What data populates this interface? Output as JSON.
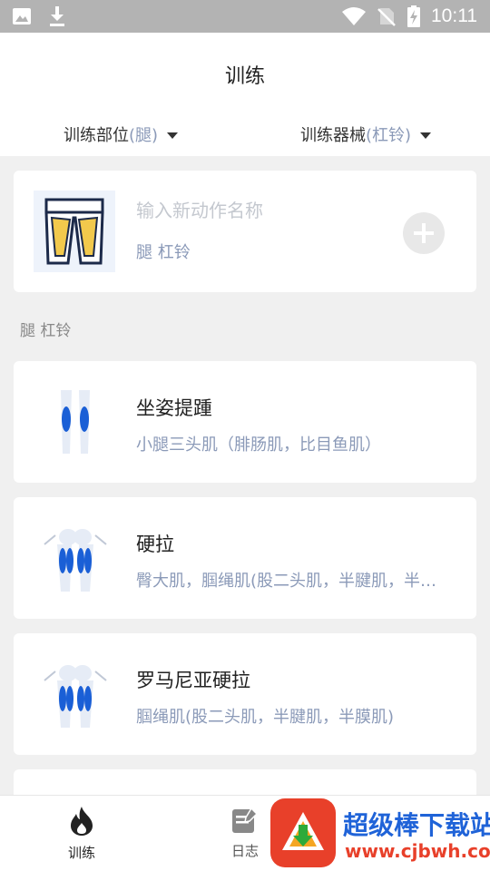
{
  "status_bar": {
    "time": "10:11",
    "left_icons": [
      "image-icon",
      "download-icon"
    ],
    "right_icons": [
      "wifi-icon",
      "no-sim-icon",
      "battery-charging-icon"
    ]
  },
  "header": {
    "title": "训练",
    "filters": [
      {
        "label": "训练部位",
        "value": "(腿)"
      },
      {
        "label": "训练器械",
        "value": "(杠铃)"
      }
    ]
  },
  "new_action": {
    "placeholder": "输入新动作名称",
    "subtitle": "腿 杠铃",
    "add_icon": "plus-circle-icon"
  },
  "section_label": "腿 杠铃",
  "exercises": [
    {
      "name": "坐姿提踵",
      "muscles": "小腿三头肌（腓肠肌，比目鱼肌）"
    },
    {
      "name": "硬拉",
      "muscles": "臀大肌，腘绳肌(股二头肌，半腱肌，半膜肌)"
    },
    {
      "name": "罗马尼亚硬拉",
      "muscles": "腘绳肌(股二头肌，半腱肌，半膜肌)"
    }
  ],
  "bottom_nav": [
    {
      "label": "训练",
      "icon": "flame-icon",
      "active": true
    },
    {
      "label": "日志",
      "icon": "notebook-icon",
      "active": false
    }
  ],
  "watermark": {
    "title": "超级棒下载站",
    "url": "www.cjbwh.com"
  },
  "colors": {
    "accent_text": "#8b9ab8",
    "status_bar": "#b3b3b3",
    "active_nav": "#222222",
    "muscle_blue": "#1a5fd6"
  }
}
